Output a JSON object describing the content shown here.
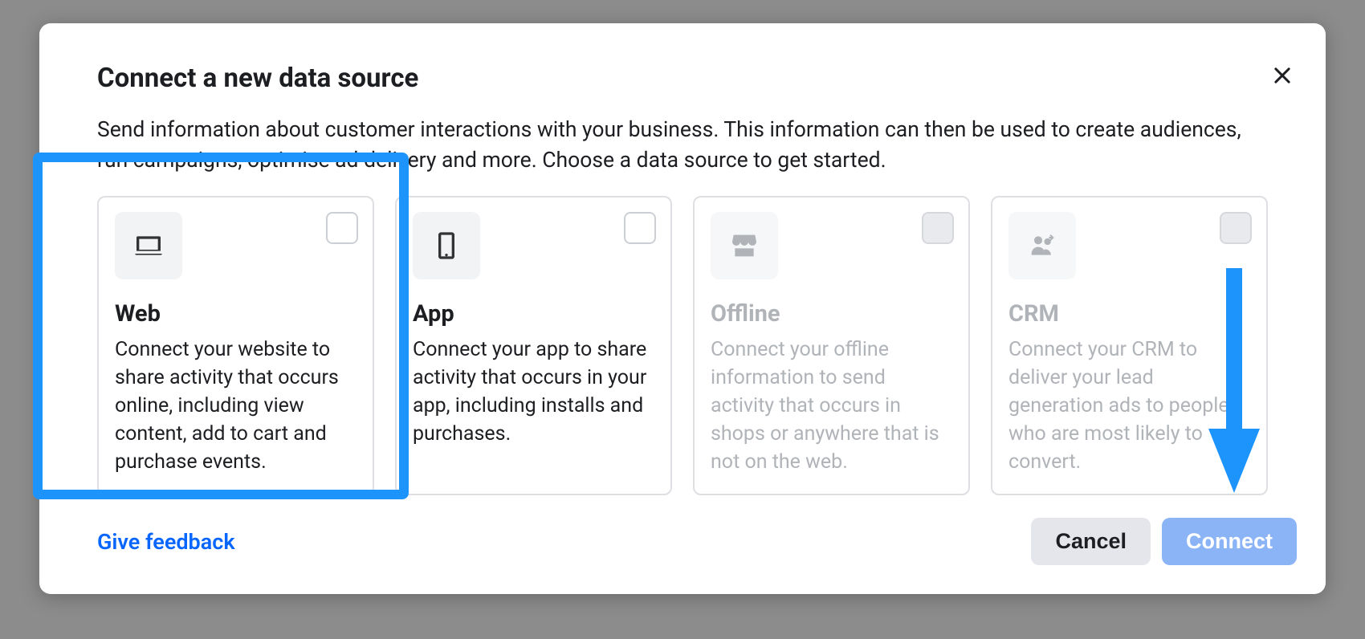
{
  "modal": {
    "title": "Connect a new data source",
    "description": "Send information about customer interactions with your business. This information can then be used to create audiences, run campaigns, optimise ad delivery and more. Choose a data source to get started."
  },
  "options": [
    {
      "id": "web",
      "title": "Web",
      "description": "Connect your website to share activity that occurs online, including view content, add to cart and purchase events.",
      "icon": "laptop-icon",
      "enabled": true
    },
    {
      "id": "app",
      "title": "App",
      "description": "Connect your app to share activity that occurs in your app, including installs and purchases.",
      "icon": "phone-icon",
      "enabled": true
    },
    {
      "id": "offline",
      "title": "Offline",
      "description": "Connect your offline information to send activity that occurs in shops or anywhere that is not on the web.",
      "icon": "store-icon",
      "enabled": false
    },
    {
      "id": "crm",
      "title": "CRM",
      "description": "Connect your CRM to deliver your lead generation ads to people who are most likely to convert.",
      "icon": "people-icon",
      "enabled": false
    }
  ],
  "footer": {
    "feedback": "Give feedback",
    "cancel": "Cancel",
    "connect": "Connect"
  },
  "annotations": {
    "highlighted_option": "web",
    "arrow_target": "connect-button"
  },
  "colors": {
    "accent": "#0866ff",
    "highlight_border": "#1d94fc",
    "primary_button_disabled": "#8bb4f7"
  }
}
